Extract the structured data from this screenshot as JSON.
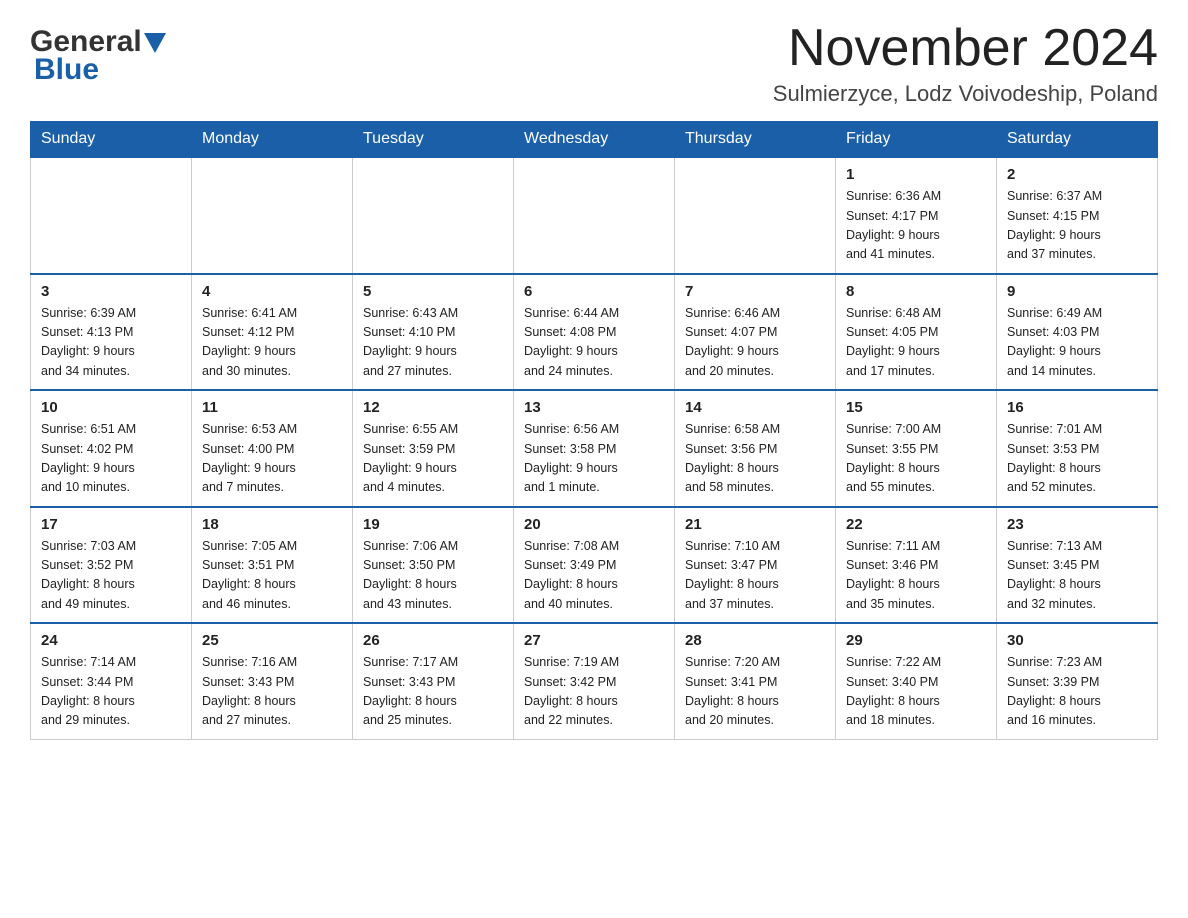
{
  "logo": {
    "general": "General",
    "blue": "Blue"
  },
  "title": "November 2024",
  "location": "Sulmierzyce, Lodz Voivodeship, Poland",
  "days_of_week": [
    "Sunday",
    "Monday",
    "Tuesday",
    "Wednesday",
    "Thursday",
    "Friday",
    "Saturday"
  ],
  "weeks": [
    [
      {
        "day": "",
        "info": ""
      },
      {
        "day": "",
        "info": ""
      },
      {
        "day": "",
        "info": ""
      },
      {
        "day": "",
        "info": ""
      },
      {
        "day": "",
        "info": ""
      },
      {
        "day": "1",
        "info": "Sunrise: 6:36 AM\nSunset: 4:17 PM\nDaylight: 9 hours\nand 41 minutes."
      },
      {
        "day": "2",
        "info": "Sunrise: 6:37 AM\nSunset: 4:15 PM\nDaylight: 9 hours\nand 37 minutes."
      }
    ],
    [
      {
        "day": "3",
        "info": "Sunrise: 6:39 AM\nSunset: 4:13 PM\nDaylight: 9 hours\nand 34 minutes."
      },
      {
        "day": "4",
        "info": "Sunrise: 6:41 AM\nSunset: 4:12 PM\nDaylight: 9 hours\nand 30 minutes."
      },
      {
        "day": "5",
        "info": "Sunrise: 6:43 AM\nSunset: 4:10 PM\nDaylight: 9 hours\nand 27 minutes."
      },
      {
        "day": "6",
        "info": "Sunrise: 6:44 AM\nSunset: 4:08 PM\nDaylight: 9 hours\nand 24 minutes."
      },
      {
        "day": "7",
        "info": "Sunrise: 6:46 AM\nSunset: 4:07 PM\nDaylight: 9 hours\nand 20 minutes."
      },
      {
        "day": "8",
        "info": "Sunrise: 6:48 AM\nSunset: 4:05 PM\nDaylight: 9 hours\nand 17 minutes."
      },
      {
        "day": "9",
        "info": "Sunrise: 6:49 AM\nSunset: 4:03 PM\nDaylight: 9 hours\nand 14 minutes."
      }
    ],
    [
      {
        "day": "10",
        "info": "Sunrise: 6:51 AM\nSunset: 4:02 PM\nDaylight: 9 hours\nand 10 minutes."
      },
      {
        "day": "11",
        "info": "Sunrise: 6:53 AM\nSunset: 4:00 PM\nDaylight: 9 hours\nand 7 minutes."
      },
      {
        "day": "12",
        "info": "Sunrise: 6:55 AM\nSunset: 3:59 PM\nDaylight: 9 hours\nand 4 minutes."
      },
      {
        "day": "13",
        "info": "Sunrise: 6:56 AM\nSunset: 3:58 PM\nDaylight: 9 hours\nand 1 minute."
      },
      {
        "day": "14",
        "info": "Sunrise: 6:58 AM\nSunset: 3:56 PM\nDaylight: 8 hours\nand 58 minutes."
      },
      {
        "day": "15",
        "info": "Sunrise: 7:00 AM\nSunset: 3:55 PM\nDaylight: 8 hours\nand 55 minutes."
      },
      {
        "day": "16",
        "info": "Sunrise: 7:01 AM\nSunset: 3:53 PM\nDaylight: 8 hours\nand 52 minutes."
      }
    ],
    [
      {
        "day": "17",
        "info": "Sunrise: 7:03 AM\nSunset: 3:52 PM\nDaylight: 8 hours\nand 49 minutes."
      },
      {
        "day": "18",
        "info": "Sunrise: 7:05 AM\nSunset: 3:51 PM\nDaylight: 8 hours\nand 46 minutes."
      },
      {
        "day": "19",
        "info": "Sunrise: 7:06 AM\nSunset: 3:50 PM\nDaylight: 8 hours\nand 43 minutes."
      },
      {
        "day": "20",
        "info": "Sunrise: 7:08 AM\nSunset: 3:49 PM\nDaylight: 8 hours\nand 40 minutes."
      },
      {
        "day": "21",
        "info": "Sunrise: 7:10 AM\nSunset: 3:47 PM\nDaylight: 8 hours\nand 37 minutes."
      },
      {
        "day": "22",
        "info": "Sunrise: 7:11 AM\nSunset: 3:46 PM\nDaylight: 8 hours\nand 35 minutes."
      },
      {
        "day": "23",
        "info": "Sunrise: 7:13 AM\nSunset: 3:45 PM\nDaylight: 8 hours\nand 32 minutes."
      }
    ],
    [
      {
        "day": "24",
        "info": "Sunrise: 7:14 AM\nSunset: 3:44 PM\nDaylight: 8 hours\nand 29 minutes."
      },
      {
        "day": "25",
        "info": "Sunrise: 7:16 AM\nSunset: 3:43 PM\nDaylight: 8 hours\nand 27 minutes."
      },
      {
        "day": "26",
        "info": "Sunrise: 7:17 AM\nSunset: 3:43 PM\nDaylight: 8 hours\nand 25 minutes."
      },
      {
        "day": "27",
        "info": "Sunrise: 7:19 AM\nSunset: 3:42 PM\nDaylight: 8 hours\nand 22 minutes."
      },
      {
        "day": "28",
        "info": "Sunrise: 7:20 AM\nSunset: 3:41 PM\nDaylight: 8 hours\nand 20 minutes."
      },
      {
        "day": "29",
        "info": "Sunrise: 7:22 AM\nSunset: 3:40 PM\nDaylight: 8 hours\nand 18 minutes."
      },
      {
        "day": "30",
        "info": "Sunrise: 7:23 AM\nSunset: 3:39 PM\nDaylight: 8 hours\nand 16 minutes."
      }
    ]
  ]
}
